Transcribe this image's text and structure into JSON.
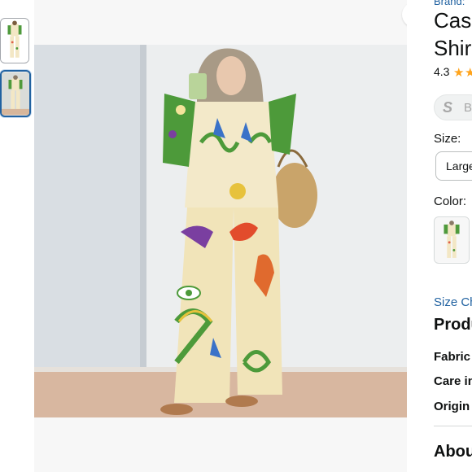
{
  "thumbnails": [
    {
      "name": "thumbnail-1",
      "selected": false
    },
    {
      "name": "thumbnail-2",
      "selected": true
    }
  ],
  "share": {
    "icon": "share-icon"
  },
  "product": {
    "brand": "Brand:",
    "title_line1": "Casu",
    "title_line2": "Shir",
    "rating": "4.3",
    "badge_letter": "S",
    "badge_text": "B"
  },
  "size": {
    "label": "Size:",
    "selected": "Large"
  },
  "color": {
    "label": "Color:"
  },
  "links": {
    "size_chart": "Size Ch"
  },
  "details": {
    "heading": "Produ",
    "fabric": "Fabric",
    "care": "Care in",
    "origin": "Origin"
  },
  "about": {
    "heading": "Abou"
  },
  "colors": {
    "accent_star": "#ffa41c",
    "link": "#2162a1",
    "selected_border": "#2162a1"
  }
}
